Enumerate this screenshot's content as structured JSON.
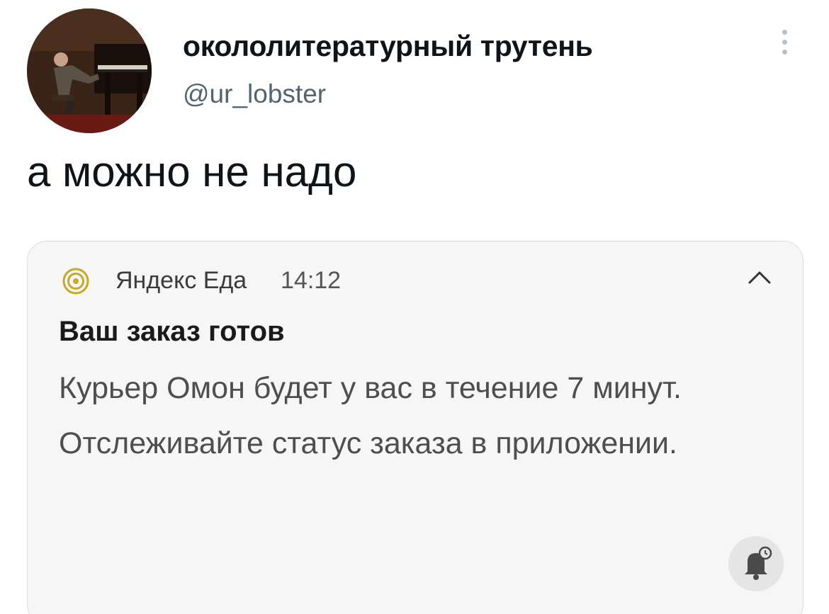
{
  "tweet": {
    "author": {
      "display_name": "окололитературный трутень",
      "handle": "@ur_lobster",
      "avatar_icon": "avatar-photo"
    },
    "more_icon": "more-vertical-icon",
    "text": "а можно не надо"
  },
  "notification": {
    "app_icon": "spiral-icon",
    "app_name": "Яндекс Еда",
    "time": "14:12",
    "collapse_icon": "chevron-up-icon",
    "title": "Ваш заказ готов",
    "body": "Курьер Омон будет у вас в течение 7 минут. Отслеживайте статус заказа в приложении.",
    "action_icon": "bell-snooze-icon"
  },
  "colors": {
    "text_primary": "#0f1419",
    "text_secondary": "#536471",
    "card_background": "#f6f6f6",
    "card_border": "#dadde1",
    "app_icon_color": "#c7a92a"
  }
}
